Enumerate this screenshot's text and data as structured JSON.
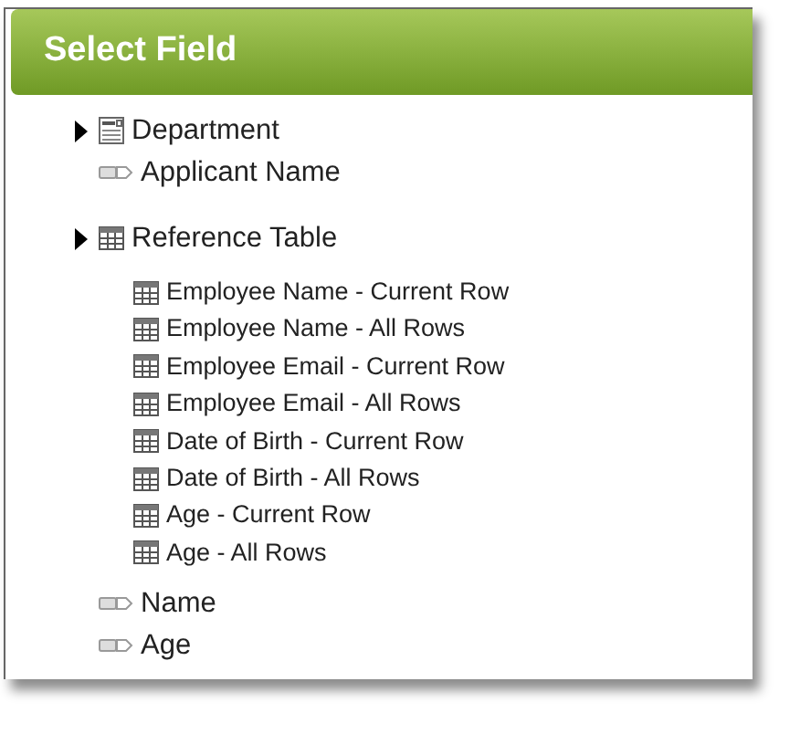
{
  "panel": {
    "title": "Select Field"
  },
  "items": [
    {
      "kind": "section",
      "label": "Department"
    },
    {
      "kind": "field",
      "label": "Applicant Name"
    },
    {
      "kind": "table",
      "label": "Reference Table",
      "children": [
        {
          "label": "Employee Name - Current Row"
        },
        {
          "label": "Employee Name - All Rows"
        },
        {
          "label": "Employee Email - Current Row"
        },
        {
          "label": "Employee Email - All Rows"
        },
        {
          "label": "Date of Birth - Current Row"
        },
        {
          "label": "Date of Birth - All Rows"
        },
        {
          "label": "Age - Current Row"
        },
        {
          "label": "Age - All Rows"
        }
      ]
    },
    {
      "kind": "field",
      "label": "Name"
    },
    {
      "kind": "field",
      "label": "Age"
    }
  ]
}
